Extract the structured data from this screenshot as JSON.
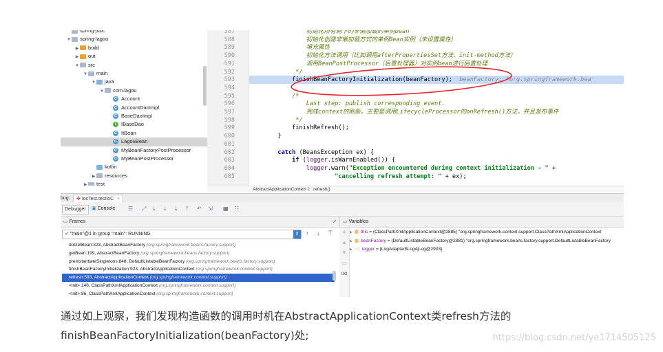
{
  "project_tree": [
    {
      "label": "spring-jdbc",
      "indent": 1,
      "arrow": "",
      "icon": "folder",
      "partial": true
    },
    {
      "label": "spring-lagou",
      "indent": 1,
      "arrow": "▼",
      "icon": "folder"
    },
    {
      "label": "build",
      "indent": 2,
      "arrow": "▶",
      "icon": "orange"
    },
    {
      "label": "out",
      "indent": 2,
      "arrow": "▶",
      "icon": "orange"
    },
    {
      "label": "src",
      "indent": 2,
      "arrow": "▼",
      "icon": "folder"
    },
    {
      "label": "main",
      "indent": 3,
      "arrow": "▼",
      "icon": "folder"
    },
    {
      "label": "java",
      "indent": 4,
      "arrow": "▼",
      "icon": "ltblue"
    },
    {
      "label": "com.lagou",
      "indent": 5,
      "arrow": "▼",
      "icon": "folder"
    },
    {
      "label": "Account",
      "indent": 6,
      "arrow": "",
      "icon": "class",
      "letter": "C"
    },
    {
      "label": "AccountDaoImpl",
      "indent": 6,
      "arrow": "",
      "icon": "class",
      "letter": "C"
    },
    {
      "label": "BaseDaoImpl",
      "indent": 6,
      "arrow": "",
      "icon": "class",
      "letter": "C"
    },
    {
      "label": "IBaseDao",
      "indent": 6,
      "arrow": "",
      "icon": "interface",
      "letter": "I"
    },
    {
      "label": "ItBean",
      "indent": 6,
      "arrow": "",
      "icon": "class",
      "letter": "C"
    },
    {
      "label": "LagouBean",
      "indent": 6,
      "arrow": "",
      "icon": "class",
      "letter": "C",
      "selected": true
    },
    {
      "label": "MyBeanFactoryPostProcessor",
      "indent": 6,
      "arrow": "",
      "icon": "class",
      "letter": "C"
    },
    {
      "label": "MyBeanPostProcessor",
      "indent": 6,
      "arrow": "",
      "icon": "class",
      "letter": "C"
    },
    {
      "label": "kotlin",
      "indent": 4,
      "arrow": "",
      "icon": "ltblue"
    },
    {
      "label": "resources",
      "indent": 4,
      "arrow": "▶",
      "icon": "folder"
    },
    {
      "label": "test",
      "indent": 3,
      "arrow": "▶",
      "icon": "folder",
      "partial": true
    }
  ],
  "editor": {
    "lines": [
      {
        "n": "587",
        "html": "<span class='doc'>                初始化所有剩下的非懒加载的单例bean</span>"
      },
      {
        "n": "588",
        "html": "<span class='doc'>                初始化创建非懒加载方式的单例Bean实例（未设置属性）</span>"
      },
      {
        "n": "589",
        "html": "<span class='doc'>                填充属性</span>"
      },
      {
        "n": "590",
        "html": "<span class='doc'>                初始化方法调用（比如调用afterPropertiesSet方法、init-method方法）</span>"
      },
      {
        "n": "591",
        "html": "<span class='doc'>                调用BeanPostProcessor（后置处理器）对实例bean进行后置处理</span>"
      },
      {
        "n": "592",
        "html": "<span class='doc'>             */</span>"
      },
      {
        "n": "593",
        "html": "            finishBeanFactoryInitialization(beanFactory);  <span class='inline-hint'>beanFactory: \"org.springframework.bea</span>",
        "hl": true
      },
      {
        "n": "594",
        "html": ""
      },
      {
        "n": "595",
        "html": "<span class='doc'>            /*</span>"
      },
      {
        "n": "596",
        "html": "<span class='doc'>                Last step: publish corresponding event.</span>"
      },
      {
        "n": "597",
        "html": "<span class='doc'>                完成context的刷新。主要是调用LifecycleProcessor的onRefresh()方法，并且发布事件</span>"
      },
      {
        "n": "598",
        "html": "<span class='doc'>             */</span>"
      },
      {
        "n": "599",
        "html": "            finishRefresh();"
      },
      {
        "n": "600",
        "html": "        }"
      },
      {
        "n": "601",
        "html": ""
      },
      {
        "n": "602",
        "html": "        <span class='kw'>catch</span> (BeansException ex) {"
      },
      {
        "n": "603",
        "html": "            <span class='kw'>if</span> (<span class='fld'>logger</span>.isWarnEnabled()) {"
      },
      {
        "n": "604",
        "html": "                <span class='fld'>logger</span>.warn(<span class='str'>\"Exception encountered during context initialization - \"</span> +"
      },
      {
        "n": "605",
        "html": "                        <span class='str'>\"cancelling refresh attempt: \"</span> + ex);"
      }
    ],
    "breadcrumb": "AbstractApplicationContext  〉  refresh()"
  },
  "debug": {
    "side_label": "bug:",
    "tab_label": "IocTest.testIoC",
    "debugger_tab": "Debugger",
    "console_tab": "Console",
    "frames_title": "Frames",
    "variables_title": "Variables",
    "thread": "\"main\"@1 in group \"main\": RUNNING",
    "frames": [
      {
        "m": "doGetBean:323, AbstractBeanFactory",
        "p": "(org.springframework.beans.factory.support)"
      },
      {
        "m": "getBean:199, AbstractBeanFactory",
        "p": "(org.springframework.beans.factory.support)"
      },
      {
        "m": "preInstantiateSingletons:848, DefaultListableBeanFactory",
        "p": "(org.springframework.beans.factory.support)"
      },
      {
        "m": "finishBeanFactoryInitialization:923, AbstractApplicationContext",
        "p": "(org.springframework.context.support)"
      },
      {
        "m": "refresh:593, AbstractApplicationContext",
        "p": "(org.springframework.context.support)",
        "selected": true
      },
      {
        "m": "<init>:146, ClassPathXmlApplicationContext",
        "p": "(org.springframework.context.support)"
      },
      {
        "m": "<init>:86, ClassPathXmlApplicationContext",
        "p": "(org.springframework.context.support)"
      }
    ],
    "variables": [
      {
        "name": "this",
        "value": " = {ClassPathXmlApplicationContext@2885} \"org.springframework.context.support.ClassPathXmlApplicationContext",
        "icon": "▦"
      },
      {
        "name": "beanFactory",
        "value": " = {DefaultListableBeanFactory@2881} \"org.springframework.beans.factory.support.DefaultListableBeanFactory",
        "icon": "▦"
      },
      {
        "name": "logger",
        "value": " = {LogAdapter$Log4jLog@2903}",
        "icon": "○○"
      }
    ]
  },
  "caption": {
    "line1": "通过如上观察，我们发现构造函数的调用时机在AbstractApplicationContext类refresh方法的",
    "line2": "finishBeanFactoryInitialization(beanFactory)处;"
  },
  "watermark": "https://blog.csdn.net/ye1714505125",
  "colors": {
    "highlight": "#c6d9f7",
    "selected_frame": "#2f65ca",
    "annotation_ellipse": "#e8262a"
  }
}
